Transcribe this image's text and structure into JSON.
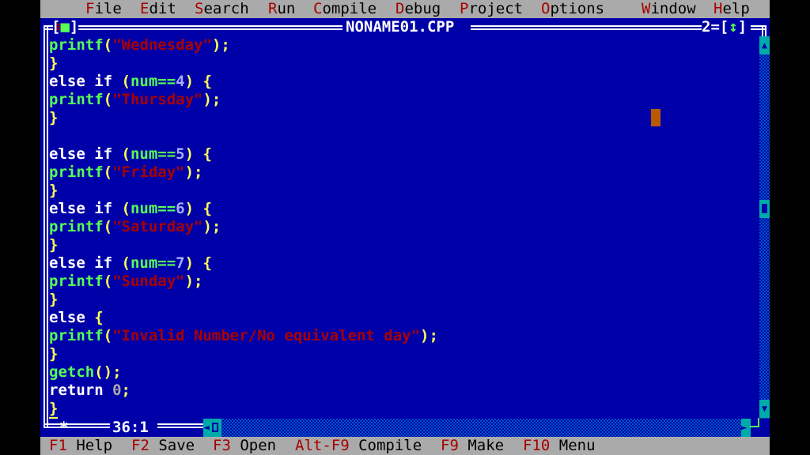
{
  "menu": {
    "system_icon": "≡",
    "items": [
      {
        "hot": "F",
        "rest": "ile"
      },
      {
        "hot": "E",
        "rest": "dit"
      },
      {
        "hot": "S",
        "rest": "earch"
      },
      {
        "hot": "R",
        "rest": "un"
      },
      {
        "hot": "C",
        "rest": "ompile"
      },
      {
        "hot": "D",
        "rest": "ebug"
      },
      {
        "hot": "P",
        "rest": "roject"
      },
      {
        "hot": "O",
        "rest": "ptions"
      },
      {
        "hot": "W",
        "rest": "indow"
      },
      {
        "hot": "H",
        "rest": "elp"
      }
    ]
  },
  "window": {
    "title": "NONAME01.CPP",
    "number": "2",
    "close_box": "■",
    "zoom_icon": "↕",
    "cursor_position": "36:1"
  },
  "editor": {
    "lines": [
      [
        {
          "t": "printf",
          "c": "fn"
        },
        {
          "t": "(",
          "c": "pn"
        },
        {
          "t": "\"Wednesday\"",
          "c": "st"
        },
        {
          "t": ");",
          "c": "pn"
        }
      ],
      [
        {
          "t": "}",
          "c": "pn"
        }
      ],
      [
        {
          "t": "else if ",
          "c": "kw"
        },
        {
          "t": "(",
          "c": "pn"
        },
        {
          "t": "num==",
          "c": "fn"
        },
        {
          "t": "4",
          "c": "nm"
        },
        {
          "t": ") {",
          "c": "pn"
        }
      ],
      [
        {
          "t": "printf",
          "c": "fn"
        },
        {
          "t": "(",
          "c": "pn"
        },
        {
          "t": "\"Thursday\"",
          "c": "st"
        },
        {
          "t": ");",
          "c": "pn"
        }
      ],
      [
        {
          "t": "}",
          "c": "pn"
        }
      ],
      [],
      [
        {
          "t": "else if ",
          "c": "kw"
        },
        {
          "t": "(",
          "c": "pn"
        },
        {
          "t": "num==",
          "c": "fn"
        },
        {
          "t": "5",
          "c": "nm"
        },
        {
          "t": ") {",
          "c": "pn"
        }
      ],
      [
        {
          "t": "printf",
          "c": "fn"
        },
        {
          "t": "(",
          "c": "pn"
        },
        {
          "t": "\"Friday\"",
          "c": "st"
        },
        {
          "t": ");",
          "c": "pn"
        }
      ],
      [
        {
          "t": "}",
          "c": "pn"
        }
      ],
      [
        {
          "t": "else if ",
          "c": "kw"
        },
        {
          "t": "(",
          "c": "pn"
        },
        {
          "t": "num==",
          "c": "fn"
        },
        {
          "t": "6",
          "c": "nm"
        },
        {
          "t": ") {",
          "c": "pn"
        }
      ],
      [
        {
          "t": "printf",
          "c": "fn"
        },
        {
          "t": "(",
          "c": "pn"
        },
        {
          "t": "\"Saturday\"",
          "c": "st"
        },
        {
          "t": ");",
          "c": "pn"
        }
      ],
      [
        {
          "t": "}",
          "c": "pn"
        }
      ],
      [
        {
          "t": "else if ",
          "c": "kw"
        },
        {
          "t": "(",
          "c": "pn"
        },
        {
          "t": "num==",
          "c": "fn"
        },
        {
          "t": "7",
          "c": "nm"
        },
        {
          "t": ") {",
          "c": "pn"
        }
      ],
      [
        {
          "t": "printf",
          "c": "fn"
        },
        {
          "t": "(",
          "c": "pn"
        },
        {
          "t": "\"Sunday\"",
          "c": "st"
        },
        {
          "t": ");",
          "c": "pn"
        }
      ],
      [
        {
          "t": "}",
          "c": "pn"
        }
      ],
      [
        {
          "t": "else ",
          "c": "kw"
        },
        {
          "t": "{",
          "c": "pn"
        }
      ],
      [
        {
          "t": "printf",
          "c": "fn"
        },
        {
          "t": "(",
          "c": "pn"
        },
        {
          "t": "\"Invalid Number/No equivalent day\"",
          "c": "st"
        },
        {
          "t": ");",
          "c": "pn"
        }
      ],
      [
        {
          "t": "}",
          "c": "pn"
        }
      ],
      [
        {
          "t": "getch",
          "c": "fn"
        },
        {
          "t": "();",
          "c": "pn"
        }
      ],
      [
        {
          "t": "return ",
          "c": "kw"
        },
        {
          "t": "0",
          "c": "num0"
        },
        {
          "t": ";",
          "c": "pn"
        }
      ],
      [
        {
          "t": "}",
          "c": "pn",
          "cursor": true
        }
      ]
    ]
  },
  "scrollbars": {
    "up_arrow": "▲",
    "down_arrow": "▼",
    "left_arrow": "◄",
    "right_arrow": "►"
  },
  "statusbar": {
    "items": [
      {
        "key": "F1",
        "label": "Help"
      },
      {
        "key": "F2",
        "label": "Save"
      },
      {
        "key": "F3",
        "label": "Open"
      },
      {
        "key": "Alt-F9",
        "label": "Compile"
      },
      {
        "key": "F9",
        "label": "Make"
      },
      {
        "key": "F10",
        "label": "Menu"
      }
    ]
  },
  "colors": {
    "background": "#0000a8",
    "menu_bg": "#aaaaaa",
    "hotkey": "#a80000",
    "string": "#a80000",
    "identifier": "#55ff55",
    "punctuation": "#ffff55",
    "keyword": "#ffffff",
    "scroll": "#00aaaa"
  }
}
